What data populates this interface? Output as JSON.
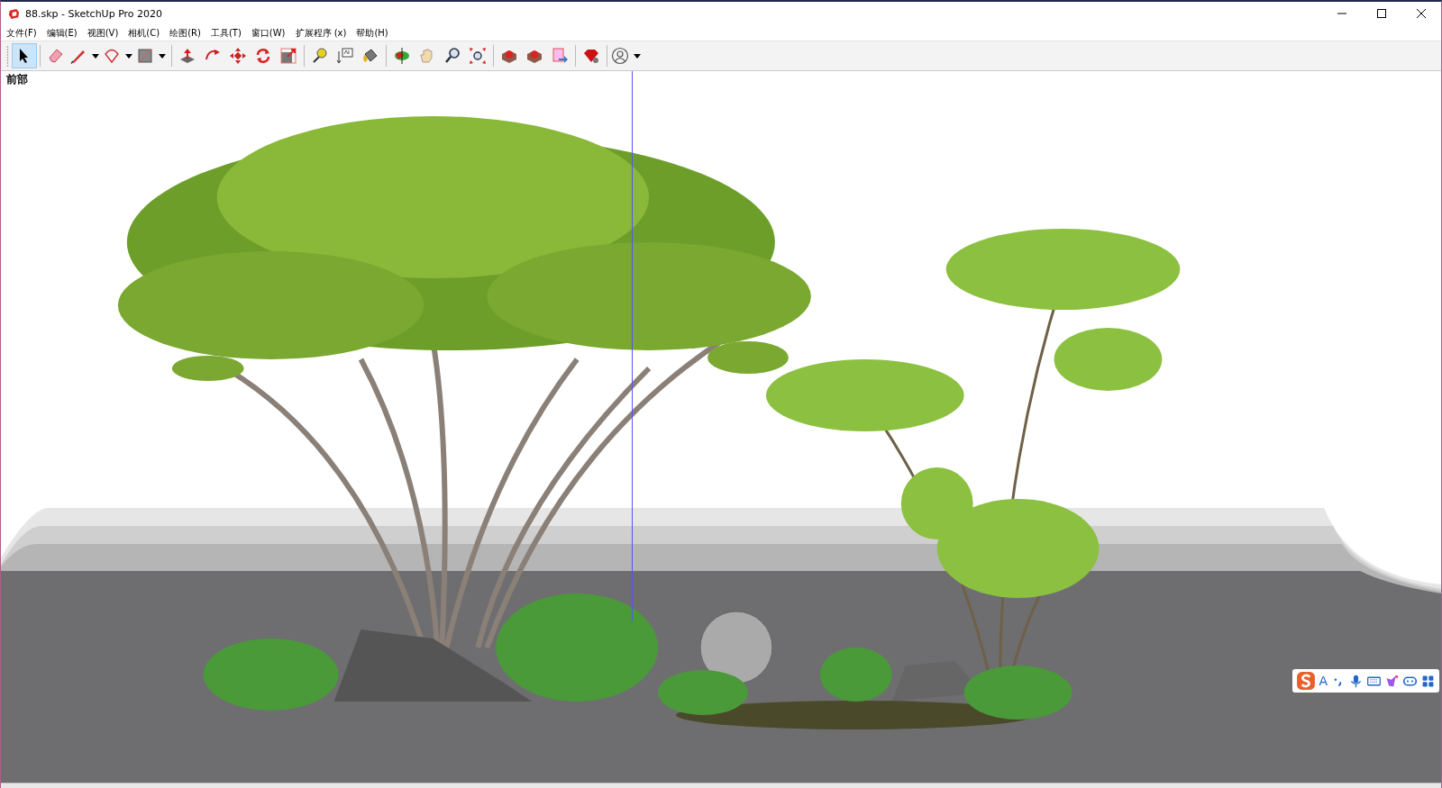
{
  "window": {
    "title": "88.skp - SketchUp Pro 2020"
  },
  "menu": [
    "文件(F)",
    "编辑(E)",
    "视图(V)",
    "相机(C)",
    "绘图(R)",
    "工具(T)",
    "窗口(W)",
    "扩展程序 (x)",
    "帮助(H)"
  ],
  "toolbar": {
    "groups": [
      [
        {
          "kind": "select",
          "selected": true,
          "dropdown": false
        }
      ],
      [
        {
          "kind": "eraser",
          "selected": false,
          "dropdown": false
        },
        {
          "kind": "pencil",
          "selected": false,
          "dropdown": true
        },
        {
          "kind": "arc",
          "selected": false,
          "dropdown": true
        },
        {
          "kind": "rectangle",
          "selected": false,
          "dropdown": true
        }
      ],
      [
        {
          "kind": "pushpull",
          "selected": false,
          "dropdown": false
        },
        {
          "kind": "followme",
          "selected": false,
          "dropdown": false
        },
        {
          "kind": "move",
          "selected": false,
          "dropdown": false
        },
        {
          "kind": "rotate",
          "selected": false,
          "dropdown": false
        },
        {
          "kind": "scale",
          "selected": false,
          "dropdown": false
        }
      ],
      [
        {
          "kind": "tape",
          "selected": false,
          "dropdown": false
        },
        {
          "kind": "text",
          "selected": false,
          "dropdown": false
        },
        {
          "kind": "paint",
          "selected": false,
          "dropdown": false
        }
      ],
      [
        {
          "kind": "orbit",
          "selected": false,
          "dropdown": false
        },
        {
          "kind": "pan",
          "selected": false,
          "dropdown": false
        },
        {
          "kind": "zoom",
          "selected": false,
          "dropdown": false
        },
        {
          "kind": "extents",
          "selected": false,
          "dropdown": false
        }
      ],
      [
        {
          "kind": "warehouse",
          "selected": false,
          "dropdown": false
        },
        {
          "kind": "extensions",
          "selected": false,
          "dropdown": false
        },
        {
          "kind": "layout",
          "selected": false,
          "dropdown": false
        }
      ],
      [
        {
          "kind": "gem",
          "selected": false,
          "dropdown": false
        }
      ],
      [
        {
          "kind": "account",
          "selected": false,
          "dropdown": true
        }
      ]
    ]
  },
  "viewport": {
    "view_label": "前部"
  },
  "ime_toolbar": {
    "mode": "A"
  }
}
